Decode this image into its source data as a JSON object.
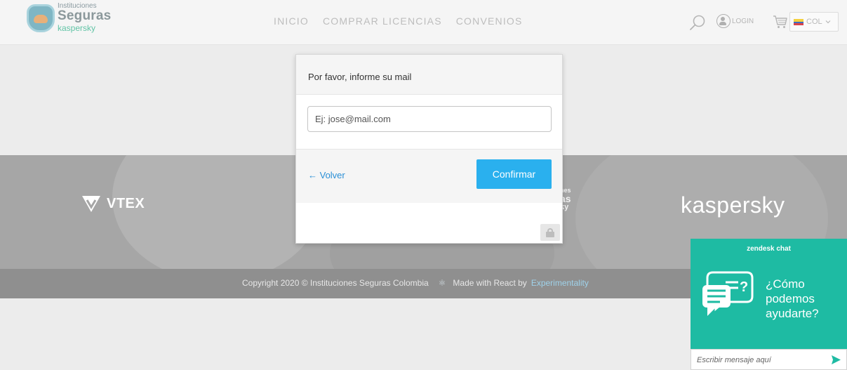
{
  "header": {
    "logo": {
      "line1": "Instituciones",
      "line2": "Seguras",
      "line3": "kaspersky"
    },
    "nav": [
      {
        "label": "INICIO"
      },
      {
        "label": "COMPRAR LICENCIAS"
      },
      {
        "label": "CONVENIOS"
      }
    ],
    "login_label": "LOGIN",
    "currency": "COL",
    "icons": [
      "search-icon",
      "user-icon",
      "cart-icon",
      "flag-colombia-icon",
      "chevron-down-icon"
    ]
  },
  "band": {
    "vtex_label": "VTEX",
    "kaspersky_label": "kaspersky",
    "partial_logo": [
      "nes",
      "as",
      "ky"
    ]
  },
  "footer": {
    "copyright": "Copyright 2020 © Instituciones Seguras Colombia",
    "made_with": "Made with React by",
    "link": "Experimentality"
  },
  "modal": {
    "title": "Por favor, informe su mail",
    "email_placeholder": "Ej: jose@mail.com",
    "back_label": "← Volver",
    "confirm_label": "Confirmar"
  },
  "chat": {
    "brand": "zendesk chat",
    "message_lines": [
      "¿Cómo",
      "podemos",
      "ayudarte?"
    ],
    "input_placeholder": "Escribir mensaje aquí"
  },
  "colors": {
    "accent": "#2ab0ee",
    "link": "#2a8fd6",
    "chat": "#1ebba3",
    "band": "#a6a6a6"
  }
}
